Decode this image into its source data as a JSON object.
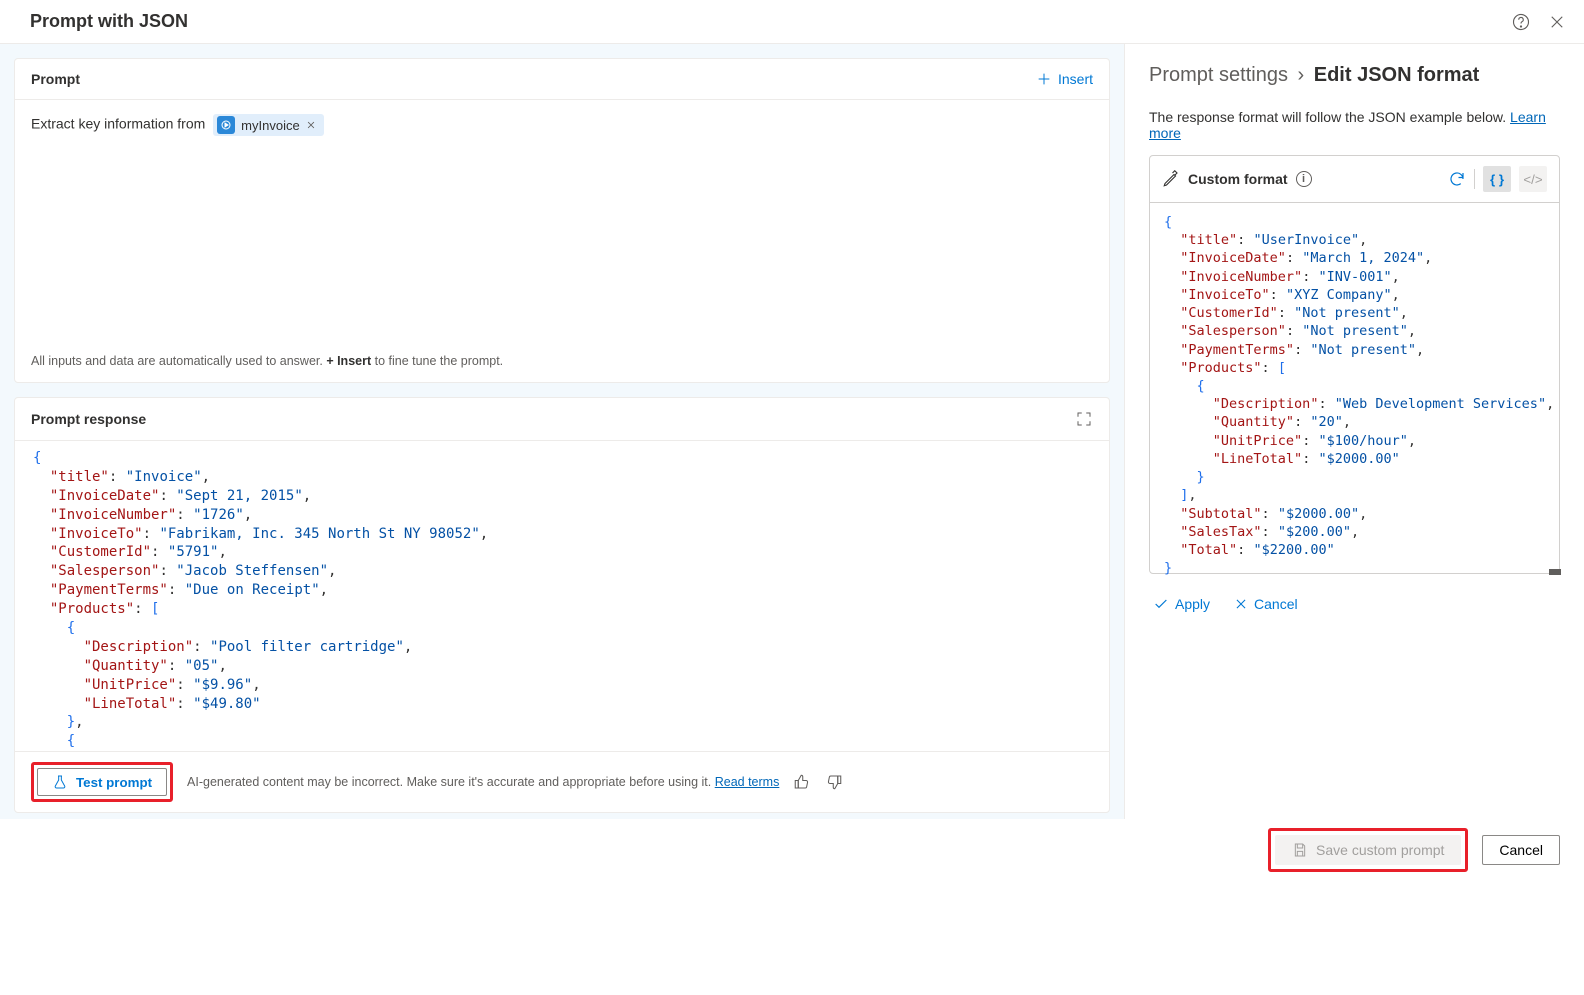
{
  "header": {
    "title": "Prompt with JSON"
  },
  "prompt": {
    "section_title": "Prompt",
    "insert_label": "Insert",
    "text": "Extract key information from",
    "chip_label": "myInvoice",
    "hint_before": "All inputs and data are automatically used to answer. ",
    "hint_bold": "+ Insert",
    "hint_after": " to fine tune the prompt."
  },
  "response": {
    "section_title": "Prompt response",
    "test_label": "Test prompt",
    "ai_note": "AI-generated content may be incorrect. Make sure it's accurate and appropriate before using it. ",
    "read_terms": "Read terms",
    "json": {
      "title": "Invoice",
      "InvoiceDate": "Sept 21, 2015",
      "InvoiceNumber": "1726",
      "InvoiceTo": "Fabrikam, Inc. 345 North St NY 98052",
      "CustomerId": "5791",
      "Salesperson": "Jacob Steffensen",
      "PaymentTerms": "Due on Receipt",
      "Products": [
        {
          "Description": "Pool filter cartridge",
          "Quantity": "05",
          "UnitPrice": "$9.96",
          "LineTotal": "$49.80"
        }
      ]
    }
  },
  "panel": {
    "crumb_parent": "Prompt settings",
    "crumb_current": "Edit JSON format",
    "explain": "The response format will follow the JSON example below. ",
    "learn_more": "Learn more",
    "format_title": "Custom format",
    "example": {
      "title": "UserInvoice",
      "InvoiceDate": "March 1, 2024",
      "InvoiceNumber": "INV-001",
      "InvoiceTo": "XYZ Company",
      "CustomerId": "Not present",
      "Salesperson": "Not present",
      "PaymentTerms": "Not present",
      "Products": [
        {
          "Description": "Web Development Services",
          "Quantity": "20",
          "UnitPrice": "$100/hour",
          "LineTotal": "$2000.00"
        }
      ],
      "Subtotal": "$2000.00",
      "SalesTax": "$200.00",
      "Total": "$2200.00"
    },
    "apply_label": "Apply",
    "cancel_label": "Cancel"
  },
  "footer": {
    "save_label": "Save custom prompt",
    "cancel_label": "Cancel"
  }
}
